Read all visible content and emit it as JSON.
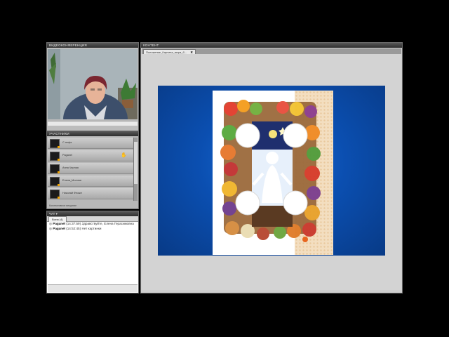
{
  "video": {
    "title": "ВИДЕОКОНФЕРЕНЦИЯ"
  },
  "participants": {
    "title": "УЧАСТНИКИ",
    "items": [
      {
        "name": "С нефа"
      },
      {
        "name": "Paganel"
      },
      {
        "name": "Анна Черная"
      },
      {
        "name": "Елена_Молова"
      },
      {
        "name": "Николай Феоже"
      }
    ],
    "footer": "Коллективное вещание"
  },
  "chat": {
    "title": "ЧАТ ▾",
    "tab": "Всем (4)",
    "messages": [
      {
        "author": "Paganel",
        "time": "(14:37:59)",
        "text": "Здравствуйте, Елена Герасимовна"
      },
      {
        "author": "Paganel",
        "time": "(14:52:45)",
        "text": "Нет картинки"
      }
    ]
  },
  "content": {
    "title": "КОНТЕНТ",
    "doc_tab": "Положение_Картина_мира_б...",
    "doc_tab_close": "✖"
  },
  "colors": {
    "slide_blue": "#0b4fb1",
    "accent_orange": "#f2a400"
  }
}
